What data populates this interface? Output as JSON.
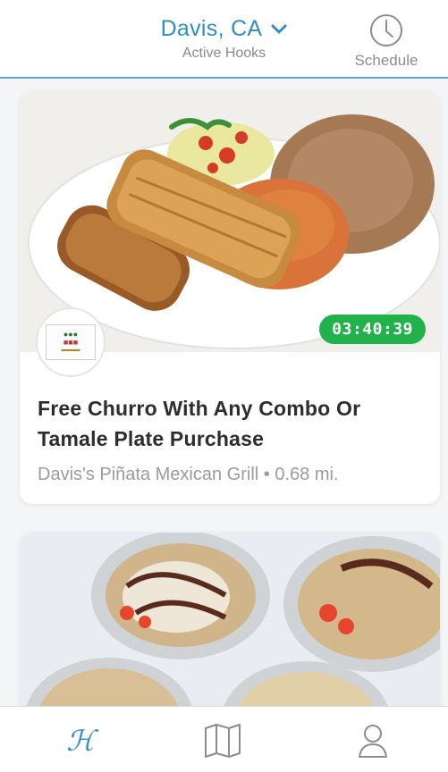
{
  "header": {
    "location": "Davis, CA",
    "subtitle": "Active Hooks",
    "schedule_label": "Schedule"
  },
  "cards": [
    {
      "timer": "03:40:39",
      "title": "Free Churro With Any Combo Or Tamale Plate Purchase",
      "vendor": "Davis's Piñata Mexican Grill",
      "distance": "0.68 mi.",
      "meta": "Davis's Piñata Mexican Grill • 0.68 mi."
    },
    {}
  ],
  "nav": {
    "home_icon": "hook-logo-icon",
    "map_icon": "map-icon",
    "profile_icon": "profile-icon",
    "home_glyph": "ℋ"
  },
  "colors": {
    "accent": "#2f8ec6",
    "timer": "#22b24c",
    "divider": "#5fa5c9"
  }
}
